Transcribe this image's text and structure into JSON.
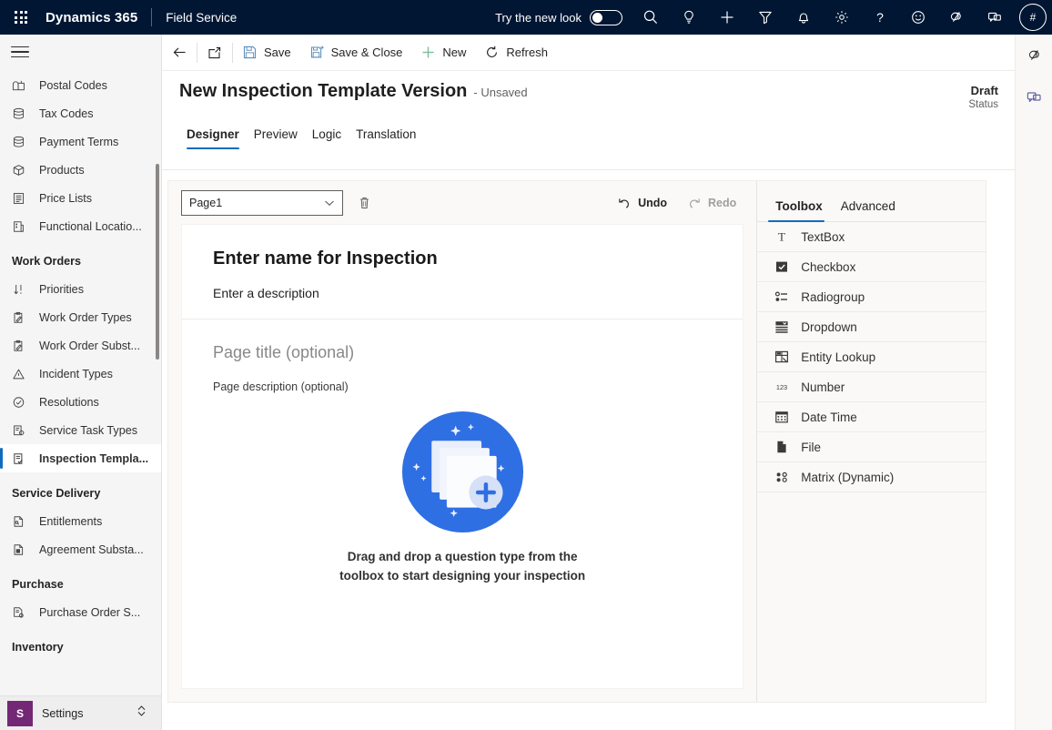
{
  "appbar": {
    "waffle_label": "app-launcher",
    "brand": "Dynamics 365",
    "app_name": "Field Service",
    "new_look_label": "Try the new look",
    "new_look_on": false,
    "icons": [
      "search-icon",
      "lightbulb-icon",
      "plus-icon",
      "filter-icon",
      "bell-icon",
      "gear-icon",
      "help-icon",
      "smiley-icon",
      "copilot-icon",
      "teams-chat-icon"
    ],
    "avatar_initials": "#"
  },
  "sidebar": {
    "hamburger_label": "site-map-toggle",
    "items": [
      {
        "label": "Postal Codes",
        "icon": "mailbox-icon",
        "selected": false
      },
      {
        "label": "Tax Codes",
        "icon": "stack-icon",
        "selected": false
      },
      {
        "label": "Payment Terms",
        "icon": "stack-icon",
        "selected": false
      },
      {
        "label": "Products",
        "icon": "box-icon",
        "selected": false
      },
      {
        "label": "Price Lists",
        "icon": "list-doc-icon",
        "selected": false
      },
      {
        "label": "Functional Locatio...",
        "icon": "building-icon",
        "selected": false
      }
    ],
    "groups": [
      {
        "title": "Work Orders",
        "items": [
          {
            "label": "Priorities",
            "icon": "sort-arrows-icon",
            "selected": false
          },
          {
            "label": "Work Order Types",
            "icon": "clipboard-pen-icon",
            "selected": false
          },
          {
            "label": "Work Order Subst...",
            "icon": "clipboard-pen-icon",
            "selected": false
          },
          {
            "label": "Incident Types",
            "icon": "warning-triangle-icon",
            "selected": false
          },
          {
            "label": "Resolutions",
            "icon": "check-circle-icon",
            "selected": false
          },
          {
            "label": "Service Task Types",
            "icon": "task-gear-icon",
            "selected": false
          },
          {
            "label": "Inspection Templa...",
            "icon": "inspection-icon",
            "selected": true
          }
        ]
      },
      {
        "title": "Service Delivery",
        "items": [
          {
            "label": "Entitlements",
            "icon": "entitlement-icon",
            "selected": false
          },
          {
            "label": "Agreement Substa...",
            "icon": "agreement-icon",
            "selected": false
          }
        ]
      },
      {
        "title": "Purchase",
        "items": [
          {
            "label": "Purchase Order S...",
            "icon": "purchase-order-icon",
            "selected": false
          }
        ]
      },
      {
        "title": "Inventory",
        "items": []
      }
    ],
    "settings": {
      "badge": "S",
      "label": "Settings",
      "chevron": "area-switcher-chevron"
    }
  },
  "commandbar": {
    "back_label": "back-icon",
    "popout_label": "open-in-new-window-icon",
    "save_label": "Save",
    "save_close_label": "Save & Close",
    "new_label": "New",
    "refresh_label": "Refresh"
  },
  "header": {
    "title": "New Inspection Template Version",
    "subtitle": "- Unsaved",
    "status_value": "Draft",
    "status_label": "Status",
    "tabs": [
      {
        "label": "Designer",
        "active": true
      },
      {
        "label": "Preview",
        "active": false
      },
      {
        "label": "Logic",
        "active": false
      },
      {
        "label": "Translation",
        "active": false
      }
    ]
  },
  "designer": {
    "page_select_value": "Page1",
    "page_select_options": [
      "Page1"
    ],
    "delete_page_label": "delete-page-icon",
    "undo_label": "Undo",
    "redo_label": "Redo",
    "undo_enabled": true,
    "redo_enabled": false,
    "canvas": {
      "inspection_name_placeholder": "Enter name for Inspection",
      "inspection_description_placeholder": "Enter a description",
      "page_title_placeholder": "Page title (optional)",
      "page_description_placeholder": "Page description (optional)",
      "empty_state_text": "Drag and drop a question type from the toolbox to start designing your inspection",
      "empty_state_art": "add-pages-illustration"
    }
  },
  "toolbox": {
    "tabs": [
      {
        "label": "Toolbox",
        "active": true
      },
      {
        "label": "Advanced",
        "active": false
      }
    ],
    "items": [
      {
        "label": "TextBox",
        "icon": "textbox-icon"
      },
      {
        "label": "Checkbox",
        "icon": "checkbox-icon"
      },
      {
        "label": "Radiogroup",
        "icon": "radiogroup-icon"
      },
      {
        "label": "Dropdown",
        "icon": "dropdown-icon"
      },
      {
        "label": "Entity Lookup",
        "icon": "entity-lookup-icon"
      },
      {
        "label": "Number",
        "icon": "number-icon"
      },
      {
        "label": "Date Time",
        "icon": "calendar-icon"
      },
      {
        "label": "File",
        "icon": "file-icon"
      },
      {
        "label": "Matrix (Dynamic)",
        "icon": "matrix-icon"
      }
    ]
  },
  "rail": {
    "items": [
      "copilot-icon",
      "chat-icon"
    ]
  },
  "colors": {
    "appbar_bg": "#001633",
    "accent": "#0f6cbd",
    "sidebar_bg": "#f5f5f5",
    "settings_badge": "#742774",
    "illustration_blue": "#2f6fe4"
  }
}
